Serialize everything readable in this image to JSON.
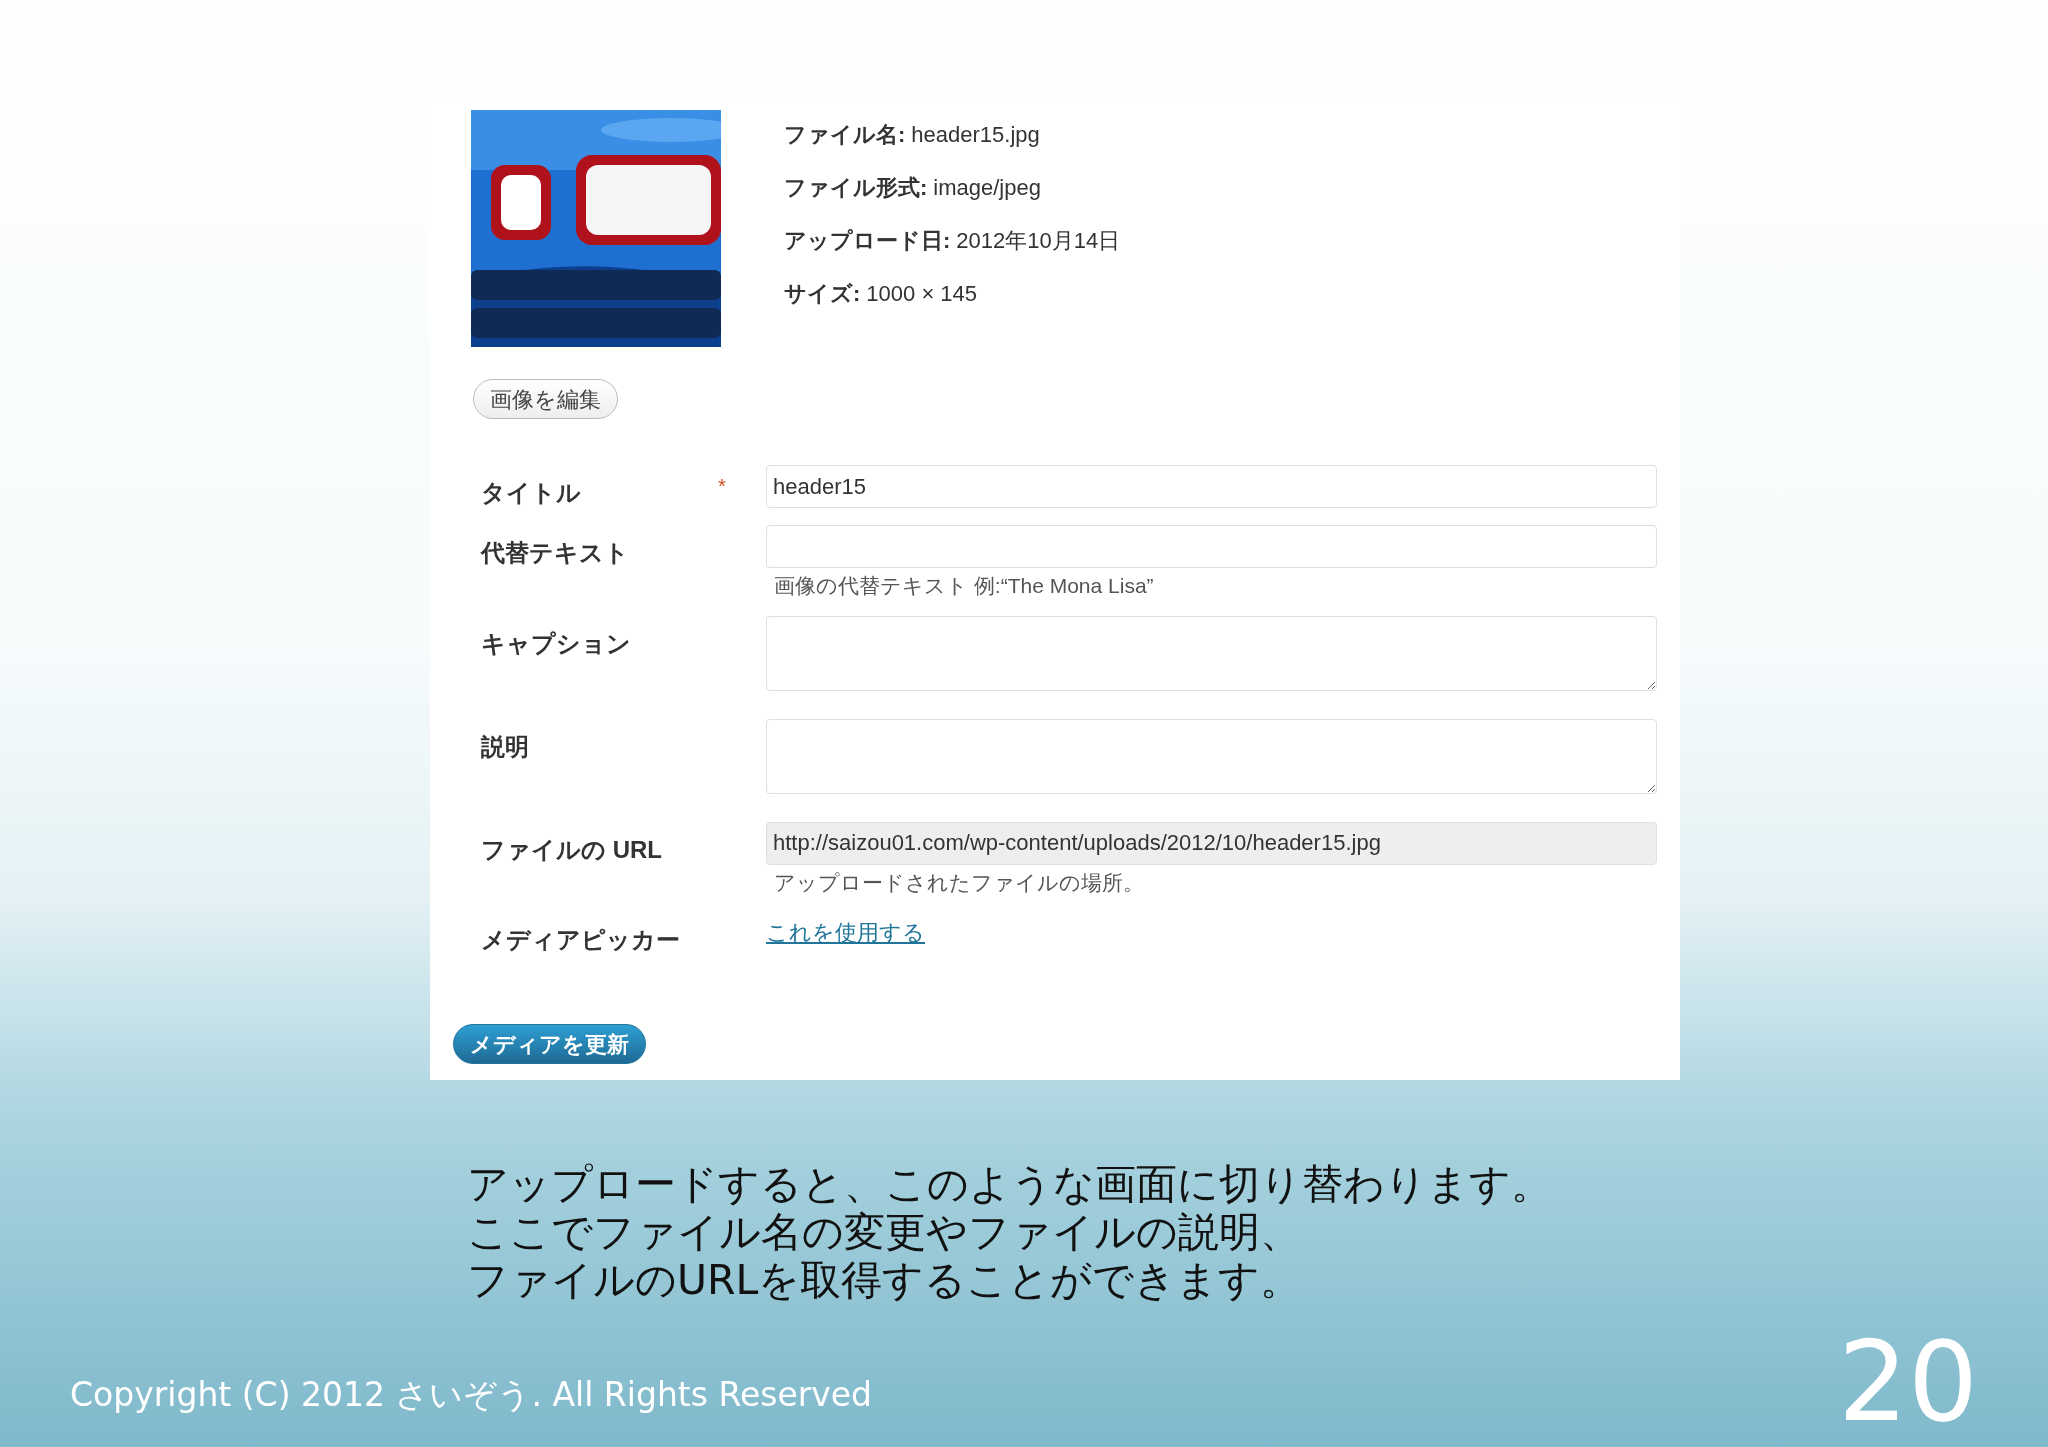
{
  "details": {
    "meta": [
      {
        "label": "ファイル名:",
        "value": "header15.jpg"
      },
      {
        "label": "ファイル形式:",
        "value": "image/jpeg"
      },
      {
        "label": "アップロード日:",
        "value": "2012年10月14日"
      },
      {
        "label": "サイズ:",
        "value": "1000 × 145"
      }
    ],
    "edit_button": "画像を編集"
  },
  "fields": [
    {
      "kind": "input",
      "label": "タイトル",
      "required_mark": "*",
      "value": "header15",
      "disabled": false
    },
    {
      "kind": "input",
      "label": "代替テキスト",
      "hint": "画像の代替テキスト 例:“The Mona Lisa”",
      "disabled": false
    },
    {
      "kind": "textarea",
      "label": "キャプション",
      "disabled": false
    },
    {
      "kind": "textarea",
      "label": "説明",
      "disabled": false
    },
    {
      "kind": "input",
      "label": "ファイルの URL",
      "value": "http://saizou01.com/wp-content/uploads/2012/10/header15.jpg",
      "hint": "アップロードされたファイルの場所。",
      "disabled": true
    },
    {
      "kind": "link",
      "label": "メディアピッカー",
      "value": "これを使用する"
    }
  ],
  "update_button": "メディアを更新",
  "slide": {
    "caption": [
      "アップロードすると、このような画面に切り替わります。",
      "ここでファイル名の変更やファイルの説明、",
      "ファイルのURLを取得することができます。"
    ],
    "footer": "Copyright (C) 2012 さいぞう. All Rights Reserved",
    "page_number": "20"
  }
}
